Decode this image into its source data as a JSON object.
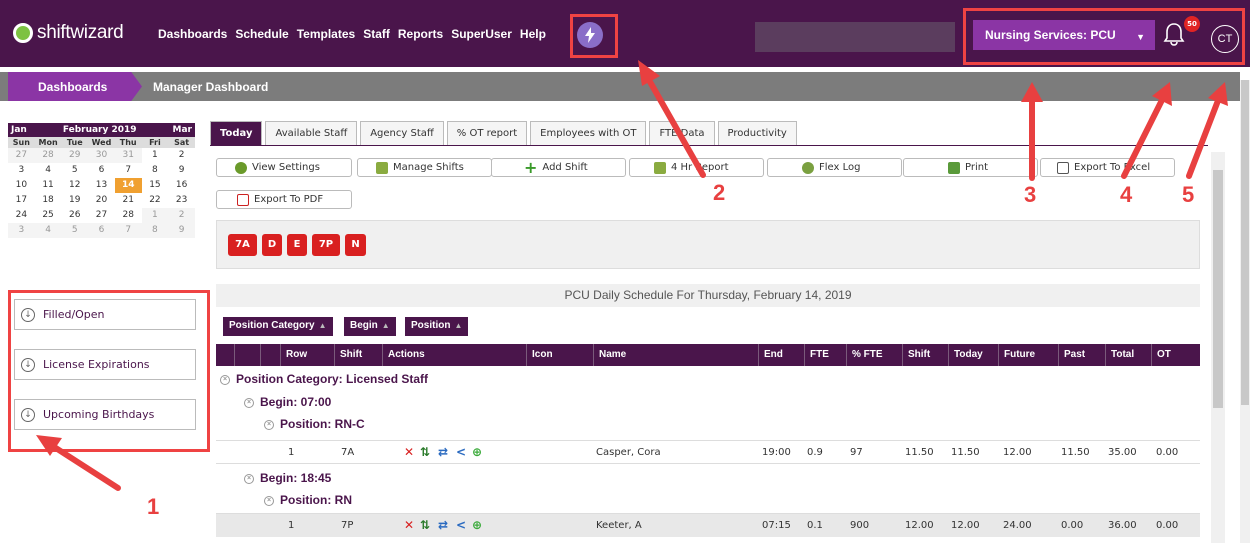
{
  "brand": {
    "name": "shiftwizard"
  },
  "nav": {
    "items": [
      "Dashboards",
      "Schedule",
      "Templates",
      "Staff",
      "Reports",
      "SuperUser",
      "Help"
    ],
    "bolt_icon": "lightning-bolt-icon"
  },
  "header": {
    "unit_select": "Nursing Services: PCU",
    "notifications_count": "50",
    "avatar_initials": "CT"
  },
  "breadcrumb": {
    "home": "Dashboards",
    "current": "Manager Dashboard"
  },
  "calendar": {
    "prev": "Jan",
    "title": "February 2019",
    "next": "Mar",
    "dow": [
      "Sun",
      "Mon",
      "Tue",
      "Wed",
      "Thu",
      "Fri",
      "Sat"
    ],
    "weeks": [
      [
        "27",
        "28",
        "29",
        "30",
        "31",
        "1",
        "2"
      ],
      [
        "3",
        "4",
        "5",
        "6",
        "7",
        "8",
        "9"
      ],
      [
        "10",
        "11",
        "12",
        "13",
        "14",
        "15",
        "16"
      ],
      [
        "17",
        "18",
        "19",
        "20",
        "21",
        "22",
        "23"
      ],
      [
        "24",
        "25",
        "26",
        "27",
        "28",
        "1",
        "2"
      ],
      [
        "3",
        "4",
        "5",
        "6",
        "7",
        "8",
        "9"
      ]
    ],
    "today": "14"
  },
  "widgets": [
    "Filled/Open",
    "License Expirations",
    "Upcoming Birthdays"
  ],
  "tabs": [
    "Today",
    "Available Staff",
    "Agency Staff",
    "% OT report",
    "Employees with OT",
    "FTE Data",
    "Productivity"
  ],
  "toolbar": {
    "view_settings": "View Settings",
    "manage_shifts": "Manage Shifts",
    "add_shift": "Add Shift",
    "hr_report": "4 Hr Report",
    "flex_log": "Flex Log",
    "print": "Print",
    "export_excel": "Export To Excel",
    "export_pdf": "Export To PDF"
  },
  "shift_codes": [
    "7A",
    "D",
    "E",
    "7P",
    "N"
  ],
  "schedule": {
    "title": "PCU Daily Schedule For Thursday, February 14, 2019",
    "group_by": [
      "Position Category",
      "Begin",
      "Position"
    ],
    "columns": [
      "Row",
      "Shift",
      "Actions",
      "Icon",
      "Name",
      "End",
      "FTE",
      "% FTE",
      "Shift",
      "Today",
      "Future",
      "Past",
      "Total",
      "OT"
    ],
    "category": "Position Category: Licensed Staff",
    "begin_1": "Begin: 07:00",
    "position_1": "Position: RN-C",
    "begin_2": "Begin: 18:45",
    "position_2": "Position: RN",
    "rows": [
      {
        "row": "1",
        "shift": "7A",
        "name": "Casper, Cora",
        "end": "19:00",
        "fte": "0.9",
        "pct_fte": "97",
        "shift_hrs": "11.50",
        "today": "11.50",
        "future": "12.00",
        "past": "11.50",
        "total": "35.00",
        "ot": "0.00"
      },
      {
        "row": "1",
        "shift": "7P",
        "name": "Keeter, A",
        "end": "07:15",
        "fte": "0.1",
        "pct_fte": "900",
        "shift_hrs": "12.00",
        "today": "12.00",
        "future": "24.00",
        "past": "0.00",
        "total": "36.00",
        "ot": "0.00"
      }
    ]
  },
  "annotations": [
    "1",
    "2",
    "3",
    "4",
    "5"
  ],
  "colors": {
    "brand_purple": "#4a154b",
    "accent_purple": "#8b35a5",
    "shift_red": "#d92020",
    "annotation_red": "#ef4343",
    "today_orange": "#f0a030"
  }
}
